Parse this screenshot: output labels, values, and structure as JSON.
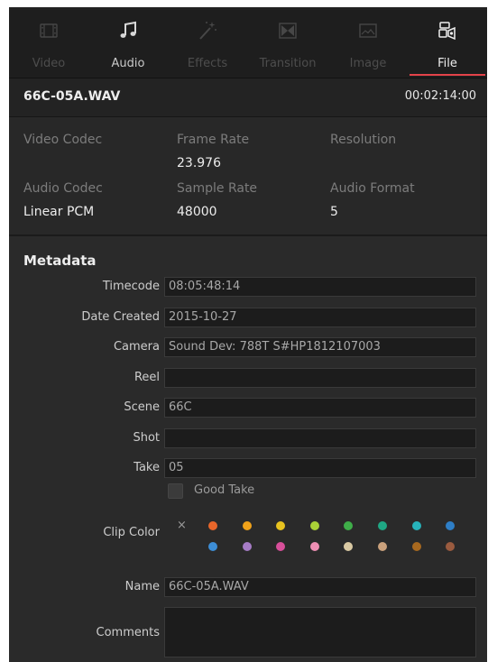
{
  "tabs": [
    {
      "label": "Video",
      "icon": "video-icon",
      "state": "disabled"
    },
    {
      "label": "Audio",
      "icon": "audio-note-icon",
      "state": "enabled"
    },
    {
      "label": "Effects",
      "icon": "magic-wand-icon",
      "state": "disabled"
    },
    {
      "label": "Transition",
      "icon": "transition-icon",
      "state": "disabled"
    },
    {
      "label": "Image",
      "icon": "image-icon",
      "state": "disabled"
    },
    {
      "label": "File",
      "icon": "file-icon",
      "state": "active"
    }
  ],
  "header": {
    "file_name": "66C-05A.WAV",
    "duration": "00:02:14:00"
  },
  "properties": {
    "video_codec": {
      "label": "Video Codec",
      "value": ""
    },
    "frame_rate": {
      "label": "Frame Rate",
      "value": "23.976"
    },
    "resolution": {
      "label": "Resolution",
      "value": ""
    },
    "audio_codec": {
      "label": "Audio Codec",
      "value": "Linear PCM"
    },
    "sample_rate": {
      "label": "Sample Rate",
      "value": "48000"
    },
    "audio_format": {
      "label": "Audio Format",
      "value": "5"
    }
  },
  "metadata": {
    "title": "Metadata",
    "timecode": {
      "label": "Timecode",
      "value": "08:05:48:14"
    },
    "date_created": {
      "label": "Date Created",
      "value": "2015-10-27"
    },
    "camera": {
      "label": "Camera",
      "value": "Sound Dev: 788T S#HP1812107003"
    },
    "reel": {
      "label": "Reel",
      "value": ""
    },
    "scene": {
      "label": "Scene",
      "value": "66C"
    },
    "shot": {
      "label": "Shot",
      "value": ""
    },
    "take": {
      "label": "Take",
      "value": "05"
    },
    "good_take": {
      "label": "Good Take",
      "checked": false
    },
    "clip_color": {
      "label": "Clip Color",
      "none_symbol": "×",
      "swatches_row1": [
        "#e8662a",
        "#f0a21a",
        "#e7c21f",
        "#a9d137",
        "#3fae49",
        "#1fa784",
        "#27b3bb",
        "#2e7ec6"
      ],
      "swatches_row2": [
        "#3d8ed6",
        "#a67cc6",
        "#d84f9a",
        "#ee8fb4",
        "#d9c9a3",
        "#caa17c",
        "#a8691f",
        "#9a5b3f"
      ]
    },
    "name": {
      "label": "Name",
      "value": "66C-05A.WAV"
    },
    "comments": {
      "label": "Comments",
      "value": ""
    }
  }
}
